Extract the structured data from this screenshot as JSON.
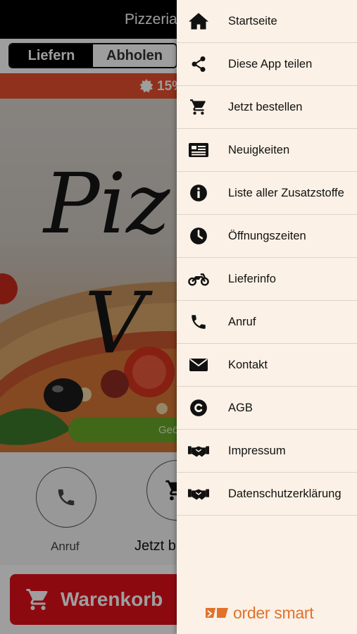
{
  "header": {
    "title": "Pizzeria V"
  },
  "order_mode": {
    "delivery_label": "Liefern",
    "pickup_label": "Abholen",
    "selected": "Liefern"
  },
  "promo": {
    "text": "15%"
  },
  "hero": {
    "geo_button_label": "Geö"
  },
  "quick_actions": [
    {
      "label": "Anruf",
      "icon": "phone-icon"
    },
    {
      "label": "Jetzt b",
      "icon": "cart-icon"
    }
  ],
  "cart": {
    "label": "Warenkorb"
  },
  "drawer": {
    "items": [
      {
        "label": "Startseite",
        "icon": "home-icon"
      },
      {
        "label": "Diese App teilen",
        "icon": "share-icon"
      },
      {
        "label": "Jetzt bestellen",
        "icon": "cart-icon"
      },
      {
        "label": "Neuigkeiten",
        "icon": "newspaper-icon"
      },
      {
        "label": "Liste aller Zusatzstoffe",
        "icon": "info-icon"
      },
      {
        "label": "Öffnungszeiten",
        "icon": "clock-icon"
      },
      {
        "label": "Lieferinfo",
        "icon": "motorcycle-icon"
      },
      {
        "label": "Anruf",
        "icon": "phone-icon"
      },
      {
        "label": "Kontakt",
        "icon": "envelope-icon"
      },
      {
        "label": "AGB",
        "icon": "copyright-icon"
      },
      {
        "label": "Impressum",
        "icon": "handshake-icon"
      },
      {
        "label": "Datenschutzerklärung",
        "icon": "handshake-icon"
      }
    ],
    "brand": "order smart"
  },
  "colors": {
    "accent_red": "#e4101b",
    "promo_orange": "#e8502f",
    "drawer_bg": "#fbf1e6",
    "brand_orange": "#e0722c",
    "geo_green": "#6aa829"
  }
}
